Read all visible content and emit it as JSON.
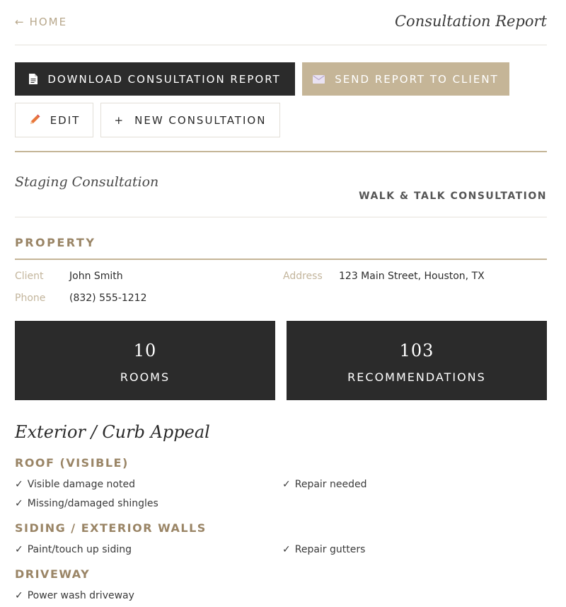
{
  "nav": {
    "home_arrow": "←",
    "home_label": "HOME",
    "page_title": "Consultation Report"
  },
  "actions": {
    "download_label": "DOWNLOAD CONSULTATION REPORT",
    "send_label": "SEND REPORT TO CLIENT",
    "edit_label": "EDIT",
    "new_plus": "+",
    "new_label": "NEW CONSULTATION"
  },
  "consultation": {
    "title": "Staging Consultation",
    "type": "WALK & TALK CONSULTATION"
  },
  "property": {
    "section_label": "PROPERTY",
    "client_label": "Client",
    "client_value": "John Smith",
    "phone_label": "Phone",
    "phone_value": "(832) 555-1212",
    "address_label": "Address",
    "address_value": "123 Main Street, Houston, TX"
  },
  "stats": [
    {
      "value": "10",
      "label": "ROOMS"
    },
    {
      "value": "103",
      "label": "RECOMMENDATIONS"
    }
  ],
  "category": {
    "title": "Exterior / Curb Appeal",
    "groups": [
      {
        "heading": "ROOF (VISIBLE)",
        "items": [
          "Visible damage noted",
          "Repair needed",
          "Missing/damaged shingles"
        ]
      },
      {
        "heading": "SIDING / EXTERIOR WALLS",
        "items": [
          "Paint/touch up siding",
          "Repair gutters"
        ]
      },
      {
        "heading": "DRIVEWAY",
        "items": [
          "Power wash driveway"
        ]
      }
    ]
  },
  "check_mark": "✓",
  "colors": {
    "accent_tan": "#c5b597",
    "dark": "#2b2b2b",
    "heading_brown": "#9a8566",
    "label_tan": "#c3b59c",
    "pencil_orange": "#e8763a"
  },
  "icons": {
    "download": "document-icon",
    "send": "envelope-icon",
    "edit": "pencil-icon"
  }
}
